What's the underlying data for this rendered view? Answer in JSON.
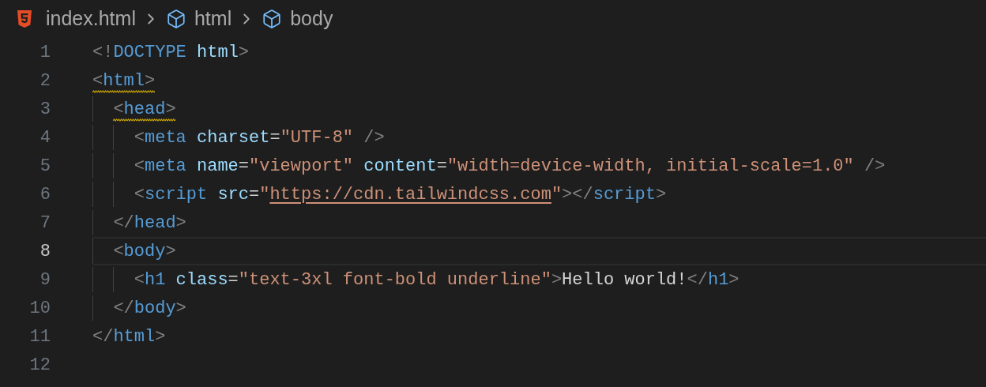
{
  "breadcrumbs": [
    {
      "kind": "file",
      "label": "index.html"
    },
    {
      "kind": "symbol",
      "label": "html"
    },
    {
      "kind": "symbol",
      "label": "body"
    }
  ],
  "editor": {
    "lines": [
      {
        "number": "1",
        "current": false,
        "warning": false,
        "tokens": [
          {
            "kind": "punct",
            "text": "<!"
          },
          {
            "kind": "tag",
            "text": "DOCTYPE "
          },
          {
            "kind": "attr",
            "text": "html"
          },
          {
            "kind": "punct",
            "text": ">"
          }
        ]
      },
      {
        "number": "2",
        "current": false,
        "warning": true,
        "tokens": [
          {
            "kind": "punct",
            "text": "<"
          },
          {
            "kind": "tag",
            "text": "html"
          },
          {
            "kind": "punct",
            "text": ">"
          }
        ],
        "children": [
          {
            "number": "3",
            "current": false,
            "warning": true,
            "tokens": [
              {
                "kind": "punct",
                "text": "<"
              },
              {
                "kind": "tag",
                "text": "head"
              },
              {
                "kind": "punct",
                "text": ">"
              }
            ],
            "children": [
              {
                "number": "4",
                "current": false,
                "warning": false,
                "tokens": [
                  {
                    "kind": "punct",
                    "text": "<"
                  },
                  {
                    "kind": "tag",
                    "text": "meta "
                  },
                  {
                    "kind": "attr",
                    "text": "charset"
                  },
                  {
                    "kind": "text",
                    "text": "="
                  },
                  {
                    "kind": "string",
                    "text": "\"UTF-8\" "
                  },
                  {
                    "kind": "punct",
                    "text": "/>"
                  }
                ]
              },
              {
                "number": "5",
                "current": false,
                "warning": false,
                "tokens": [
                  {
                    "kind": "punct",
                    "text": "<"
                  },
                  {
                    "kind": "tag",
                    "text": "meta "
                  },
                  {
                    "kind": "attr",
                    "text": "name"
                  },
                  {
                    "kind": "text",
                    "text": "="
                  },
                  {
                    "kind": "string",
                    "text": "\"viewport\" "
                  },
                  {
                    "kind": "attr",
                    "text": "content"
                  },
                  {
                    "kind": "text",
                    "text": "="
                  },
                  {
                    "kind": "string",
                    "text": "\"width=device-width, initial-scale=1.0\" "
                  },
                  {
                    "kind": "punct",
                    "text": "/>"
                  }
                ]
              },
              {
                "number": "6",
                "current": false,
                "warning": false,
                "tokens": [
                  {
                    "kind": "punct",
                    "text": "<"
                  },
                  {
                    "kind": "tag",
                    "text": "script "
                  },
                  {
                    "kind": "attr",
                    "text": "src"
                  },
                  {
                    "kind": "text",
                    "text": "="
                  },
                  {
                    "kind": "string",
                    "text": "\""
                  },
                  {
                    "kind": "link",
                    "text": "https://cdn.tailwindcss.com"
                  },
                  {
                    "kind": "string",
                    "text": "\""
                  },
                  {
                    "kind": "punct",
                    "text": "></"
                  },
                  {
                    "kind": "tag",
                    "text": "script"
                  },
                  {
                    "kind": "punct",
                    "text": ">"
                  }
                ]
              }
            ]
          },
          {
            "number": "7",
            "current": false,
            "warning": false,
            "tokens": [
              {
                "kind": "punct",
                "text": "</"
              },
              {
                "kind": "tag",
                "text": "head"
              },
              {
                "kind": "punct",
                "text": ">"
              }
            ]
          },
          {
            "number": "8",
            "current": true,
            "warning": false,
            "tokens": [
              {
                "kind": "punct",
                "text": "<"
              },
              {
                "kind": "tag",
                "text": "body"
              },
              {
                "kind": "punct",
                "text": ">"
              }
            ],
            "children": [
              {
                "number": "9",
                "current": false,
                "warning": false,
                "tokens": [
                  {
                    "kind": "punct",
                    "text": "<"
                  },
                  {
                    "kind": "tag",
                    "text": "h1 "
                  },
                  {
                    "kind": "attr",
                    "text": "class"
                  },
                  {
                    "kind": "text",
                    "text": "="
                  },
                  {
                    "kind": "string",
                    "text": "\"text-3xl font-bold underline\""
                  },
                  {
                    "kind": "punct",
                    "text": ">"
                  },
                  {
                    "kind": "text",
                    "text": "Hello world!"
                  },
                  {
                    "kind": "punct",
                    "text": "</"
                  },
                  {
                    "kind": "tag",
                    "text": "h1"
                  },
                  {
                    "kind": "punct",
                    "text": ">"
                  }
                ]
              }
            ]
          },
          {
            "number": "10",
            "current": false,
            "warning": false,
            "tokens": [
              {
                "kind": "punct",
                "text": "</"
              },
              {
                "kind": "tag",
                "text": "body"
              },
              {
                "kind": "punct",
                "text": ">"
              }
            ]
          }
        ]
      },
      {
        "number": "11",
        "current": false,
        "warning": false,
        "tokens": [
          {
            "kind": "punct",
            "text": "</"
          },
          {
            "kind": "tag",
            "text": "html"
          },
          {
            "kind": "punct",
            "text": ">"
          }
        ]
      },
      {
        "number": "12",
        "current": false,
        "warning": false
      }
    ]
  }
}
